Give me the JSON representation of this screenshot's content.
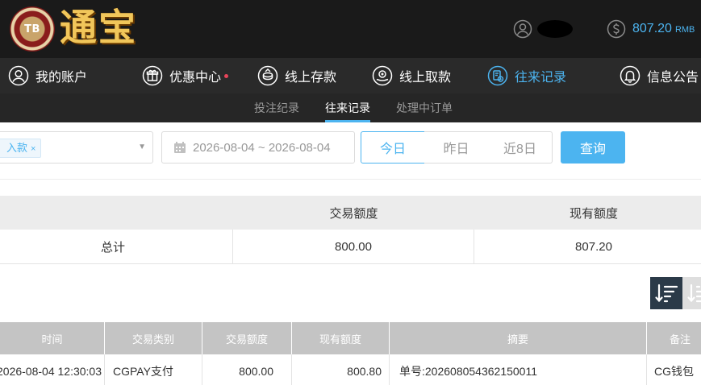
{
  "header": {
    "logo_badge": "TB",
    "logo_text": "通宝",
    "balance": "807.20",
    "currency": "RMB",
    "icons": {
      "user": "user-circle-icon",
      "balance": "dollar-coin-icon"
    }
  },
  "main_nav": {
    "items": [
      {
        "label": "我的账户",
        "icon": "user-circle-icon"
      },
      {
        "label": "优惠中心",
        "icon": "gift-icon",
        "badge_dot": true
      },
      {
        "label": "线上存款",
        "icon": "deposit-coin-icon"
      },
      {
        "label": "线上取款",
        "icon": "withdraw-coin-icon"
      },
      {
        "label": "往来记录",
        "icon": "records-history-icon",
        "active": true
      },
      {
        "label": "信息公告",
        "icon": "bell-icon"
      }
    ]
  },
  "sub_nav": {
    "items": [
      {
        "label": "投注纪录"
      },
      {
        "label": "往来记录",
        "active": true
      },
      {
        "label": "处理中订单"
      }
    ]
  },
  "filters": {
    "type_tag": "入款",
    "tag_remove": "×",
    "date_range": "2026-08-04 ~ 2026-08-04",
    "quick_ranges": [
      "今日",
      "昨日",
      "近8日"
    ],
    "selected_quick_range": "今日",
    "query_label": "查询"
  },
  "summary": {
    "headers": [
      "",
      "交易额度",
      "现有额度"
    ],
    "rows": [
      [
        "总计",
        "800.00",
        "807.20"
      ]
    ]
  },
  "sort": {
    "desc_icon": "sort-descending-icon",
    "asc_icon": "sort-ascending-icon"
  },
  "records": {
    "headers": [
      "时间",
      "交易类别",
      "交易额度",
      "现有额度",
      "摘要",
      "备注"
    ],
    "rows": [
      [
        "2026-08-04 12:30:03",
        "CGPAY支付",
        "800.00",
        "800.80",
        "单号:202608054362150011",
        "CG钱包"
      ]
    ]
  },
  "colors": {
    "accent": "#4cb4f0",
    "header_bg": "#1a1a1a",
    "nav_bg": "#2a2a2a",
    "subnav_bg": "#262626",
    "sort_active_bg": "#2b3a48",
    "table_head_bg": "#c4c4c4",
    "logo_gold": "#f1c65a",
    "badge_red": "#e8455a"
  }
}
